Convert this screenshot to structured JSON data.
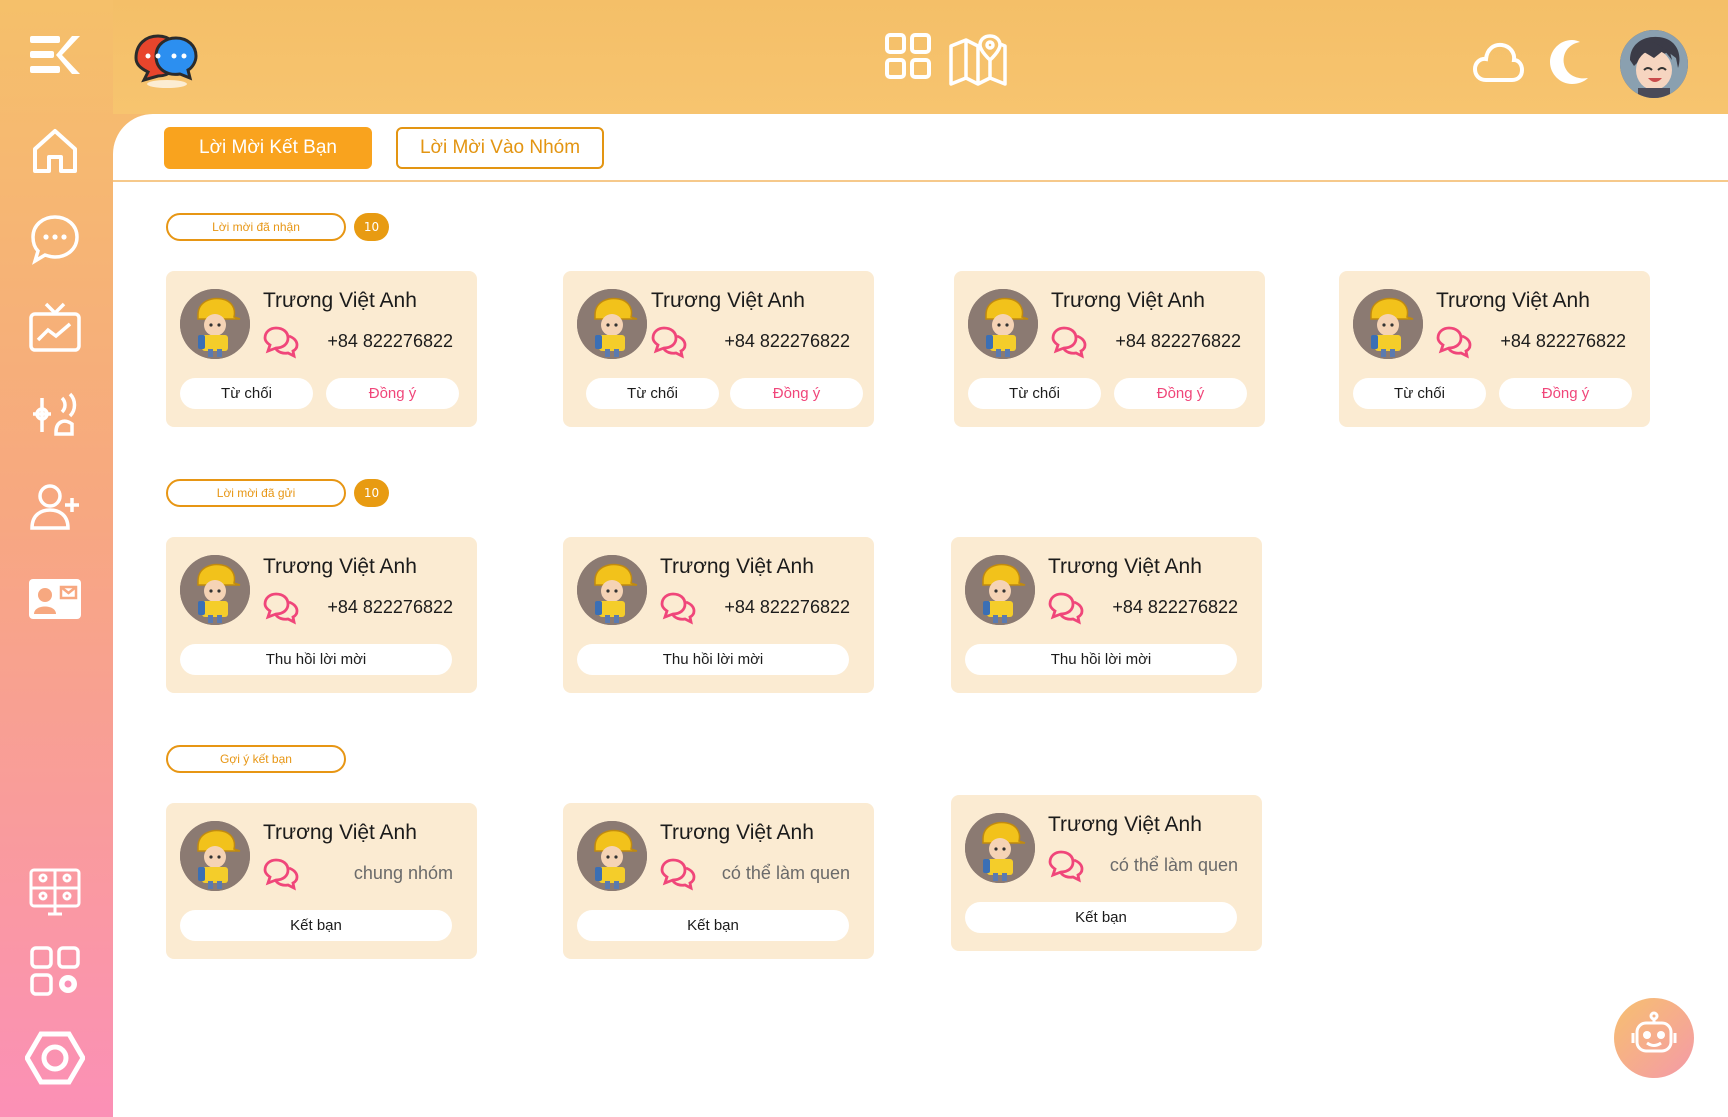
{
  "tabs": {
    "friend_requests": "Lời Mời Kết Bạn",
    "group_invites": "Lời Mời Vào Nhóm"
  },
  "sections": {
    "received": {
      "label": "Lời mời đã nhận",
      "count": "10"
    },
    "sent": {
      "label": "Lời mời đã gửi",
      "count": "10"
    },
    "suggest": {
      "label": "Gợi ý kết bạn"
    }
  },
  "received_cards": [
    {
      "name": "Trương Việt Anh",
      "phone": "+84 822276822",
      "reject": "Từ chối",
      "accept": "Đồng ý"
    },
    {
      "name": "Trương Việt Anh",
      "phone": "+84 822276822",
      "reject": "Từ chối",
      "accept": "Đồng ý"
    },
    {
      "name": "Trương Việt Anh",
      "phone": "+84 822276822",
      "reject": "Từ chối",
      "accept": "Đồng ý"
    },
    {
      "name": "Trương Việt Anh",
      "phone": "+84 822276822",
      "reject": "Từ chối",
      "accept": "Đồng ý"
    }
  ],
  "sent_cards": [
    {
      "name": "Trương Việt Anh",
      "phone": "+84 822276822",
      "revoke": "Thu hồi lời mời"
    },
    {
      "name": "Trương Việt Anh",
      "phone": "+84 822276822",
      "revoke": "Thu hồi lời mời"
    },
    {
      "name": "Trương Việt Anh",
      "phone": "+84 822276822",
      "revoke": "Thu hồi lời mời"
    }
  ],
  "suggest_cards": [
    {
      "name": "Trương Việt Anh",
      "note": "chung nhóm",
      "add": "Kết bạn"
    },
    {
      "name": "Trương Việt Anh",
      "note": "có thể làm quen",
      "add": "Kết bạn"
    },
    {
      "name": "Trương Việt Anh",
      "note": "có thể làm quen",
      "add": "Kết bạn"
    }
  ],
  "colors": {
    "accent": "#f9a31e",
    "pink": "#f0467a",
    "card": "#fbebd2"
  },
  "icons": [
    "menu-collapse-icon",
    "home-icon",
    "chat-icon",
    "tv-icon",
    "music-icon",
    "add-user-icon",
    "contact-card-icon",
    "video-grid-icon",
    "apps-settings-icon",
    "hexagon-settings-icon",
    "grid-icon",
    "map-icon",
    "cloud-icon",
    "moon-icon",
    "robot-icon"
  ]
}
